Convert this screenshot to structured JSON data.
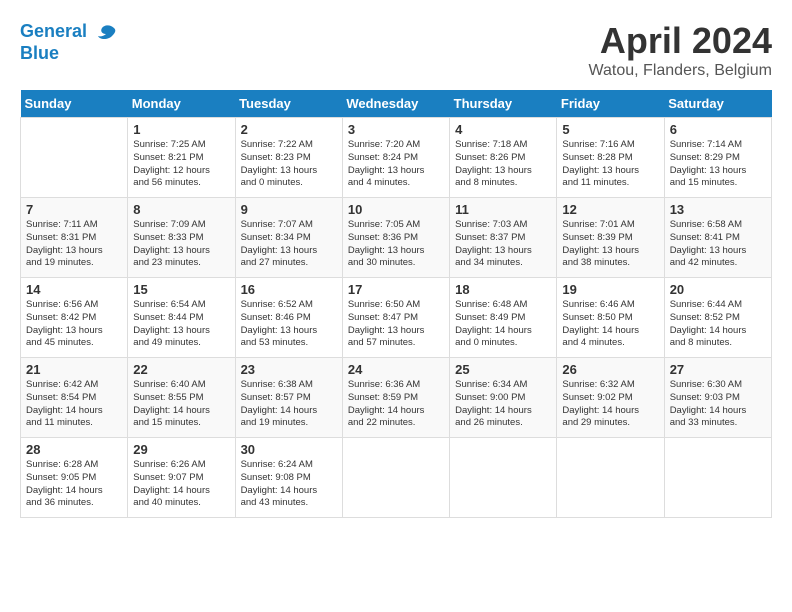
{
  "header": {
    "logo_line1": "General",
    "logo_line2": "Blue",
    "month": "April 2024",
    "location": "Watou, Flanders, Belgium"
  },
  "weekdays": [
    "Sunday",
    "Monday",
    "Tuesday",
    "Wednesday",
    "Thursday",
    "Friday",
    "Saturday"
  ],
  "weeks": [
    [
      {
        "day": "",
        "info": ""
      },
      {
        "day": "1",
        "info": "Sunrise: 7:25 AM\nSunset: 8:21 PM\nDaylight: 12 hours\nand 56 minutes."
      },
      {
        "day": "2",
        "info": "Sunrise: 7:22 AM\nSunset: 8:23 PM\nDaylight: 13 hours\nand 0 minutes."
      },
      {
        "day": "3",
        "info": "Sunrise: 7:20 AM\nSunset: 8:24 PM\nDaylight: 13 hours\nand 4 minutes."
      },
      {
        "day": "4",
        "info": "Sunrise: 7:18 AM\nSunset: 8:26 PM\nDaylight: 13 hours\nand 8 minutes."
      },
      {
        "day": "5",
        "info": "Sunrise: 7:16 AM\nSunset: 8:28 PM\nDaylight: 13 hours\nand 11 minutes."
      },
      {
        "day": "6",
        "info": "Sunrise: 7:14 AM\nSunset: 8:29 PM\nDaylight: 13 hours\nand 15 minutes."
      }
    ],
    [
      {
        "day": "7",
        "info": "Sunrise: 7:11 AM\nSunset: 8:31 PM\nDaylight: 13 hours\nand 19 minutes."
      },
      {
        "day": "8",
        "info": "Sunrise: 7:09 AM\nSunset: 8:33 PM\nDaylight: 13 hours\nand 23 minutes."
      },
      {
        "day": "9",
        "info": "Sunrise: 7:07 AM\nSunset: 8:34 PM\nDaylight: 13 hours\nand 27 minutes."
      },
      {
        "day": "10",
        "info": "Sunrise: 7:05 AM\nSunset: 8:36 PM\nDaylight: 13 hours\nand 30 minutes."
      },
      {
        "day": "11",
        "info": "Sunrise: 7:03 AM\nSunset: 8:37 PM\nDaylight: 13 hours\nand 34 minutes."
      },
      {
        "day": "12",
        "info": "Sunrise: 7:01 AM\nSunset: 8:39 PM\nDaylight: 13 hours\nand 38 minutes."
      },
      {
        "day": "13",
        "info": "Sunrise: 6:58 AM\nSunset: 8:41 PM\nDaylight: 13 hours\nand 42 minutes."
      }
    ],
    [
      {
        "day": "14",
        "info": "Sunrise: 6:56 AM\nSunset: 8:42 PM\nDaylight: 13 hours\nand 45 minutes."
      },
      {
        "day": "15",
        "info": "Sunrise: 6:54 AM\nSunset: 8:44 PM\nDaylight: 13 hours\nand 49 minutes."
      },
      {
        "day": "16",
        "info": "Sunrise: 6:52 AM\nSunset: 8:46 PM\nDaylight: 13 hours\nand 53 minutes."
      },
      {
        "day": "17",
        "info": "Sunrise: 6:50 AM\nSunset: 8:47 PM\nDaylight: 13 hours\nand 57 minutes."
      },
      {
        "day": "18",
        "info": "Sunrise: 6:48 AM\nSunset: 8:49 PM\nDaylight: 14 hours\nand 0 minutes."
      },
      {
        "day": "19",
        "info": "Sunrise: 6:46 AM\nSunset: 8:50 PM\nDaylight: 14 hours\nand 4 minutes."
      },
      {
        "day": "20",
        "info": "Sunrise: 6:44 AM\nSunset: 8:52 PM\nDaylight: 14 hours\nand 8 minutes."
      }
    ],
    [
      {
        "day": "21",
        "info": "Sunrise: 6:42 AM\nSunset: 8:54 PM\nDaylight: 14 hours\nand 11 minutes."
      },
      {
        "day": "22",
        "info": "Sunrise: 6:40 AM\nSunset: 8:55 PM\nDaylight: 14 hours\nand 15 minutes."
      },
      {
        "day": "23",
        "info": "Sunrise: 6:38 AM\nSunset: 8:57 PM\nDaylight: 14 hours\nand 19 minutes."
      },
      {
        "day": "24",
        "info": "Sunrise: 6:36 AM\nSunset: 8:59 PM\nDaylight: 14 hours\nand 22 minutes."
      },
      {
        "day": "25",
        "info": "Sunrise: 6:34 AM\nSunset: 9:00 PM\nDaylight: 14 hours\nand 26 minutes."
      },
      {
        "day": "26",
        "info": "Sunrise: 6:32 AM\nSunset: 9:02 PM\nDaylight: 14 hours\nand 29 minutes."
      },
      {
        "day": "27",
        "info": "Sunrise: 6:30 AM\nSunset: 9:03 PM\nDaylight: 14 hours\nand 33 minutes."
      }
    ],
    [
      {
        "day": "28",
        "info": "Sunrise: 6:28 AM\nSunset: 9:05 PM\nDaylight: 14 hours\nand 36 minutes."
      },
      {
        "day": "29",
        "info": "Sunrise: 6:26 AM\nSunset: 9:07 PM\nDaylight: 14 hours\nand 40 minutes."
      },
      {
        "day": "30",
        "info": "Sunrise: 6:24 AM\nSunset: 9:08 PM\nDaylight: 14 hours\nand 43 minutes."
      },
      {
        "day": "",
        "info": ""
      },
      {
        "day": "",
        "info": ""
      },
      {
        "day": "",
        "info": ""
      },
      {
        "day": "",
        "info": ""
      }
    ]
  ]
}
